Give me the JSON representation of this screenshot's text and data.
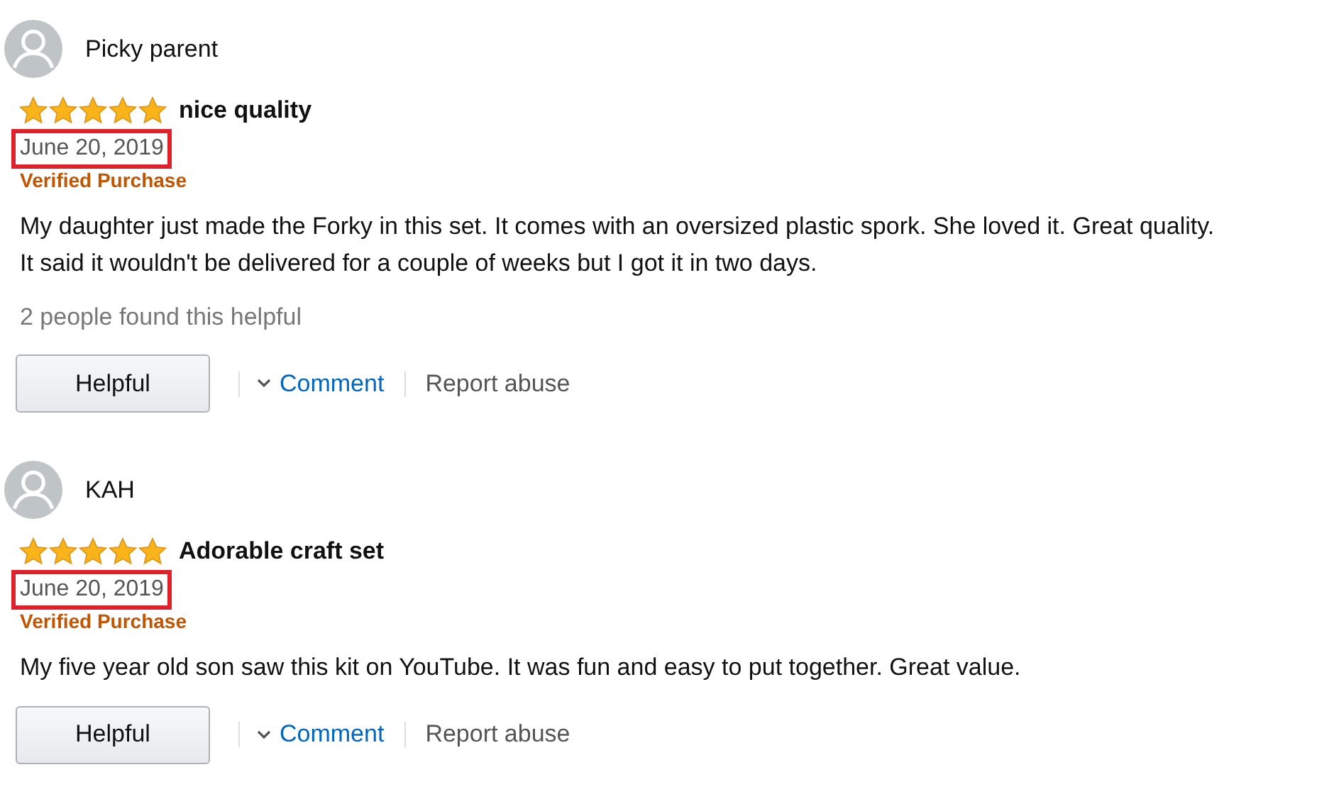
{
  "reviews": [
    {
      "reviewer": "Picky parent",
      "stars": 5,
      "title": "nice quality",
      "date": "June 20, 2019",
      "date_highlighted": true,
      "badge": "Verified Purchase",
      "body": [
        "My daughter just made the Forky in this set. It comes with an oversized plastic spork. She loved it. Great quality.",
        "It said it wouldn't be delivered for a couple of weeks but I got it in two days."
      ],
      "helpful_count": "2 people found this helpful",
      "actions": {
        "helpful": "Helpful",
        "comment": "Comment",
        "report": "Report abuse"
      }
    },
    {
      "reviewer": "KAH",
      "stars": 5,
      "title": "Adorable craft set",
      "date": "June 20, 2019",
      "date_highlighted": true,
      "badge": "Verified Purchase",
      "body": [
        "My five year old son saw this kit on YouTube. It was fun and easy to put together. Great value."
      ],
      "actions": {
        "helpful": "Helpful",
        "comment": "Comment",
        "report": "Report abuse"
      }
    }
  ]
}
